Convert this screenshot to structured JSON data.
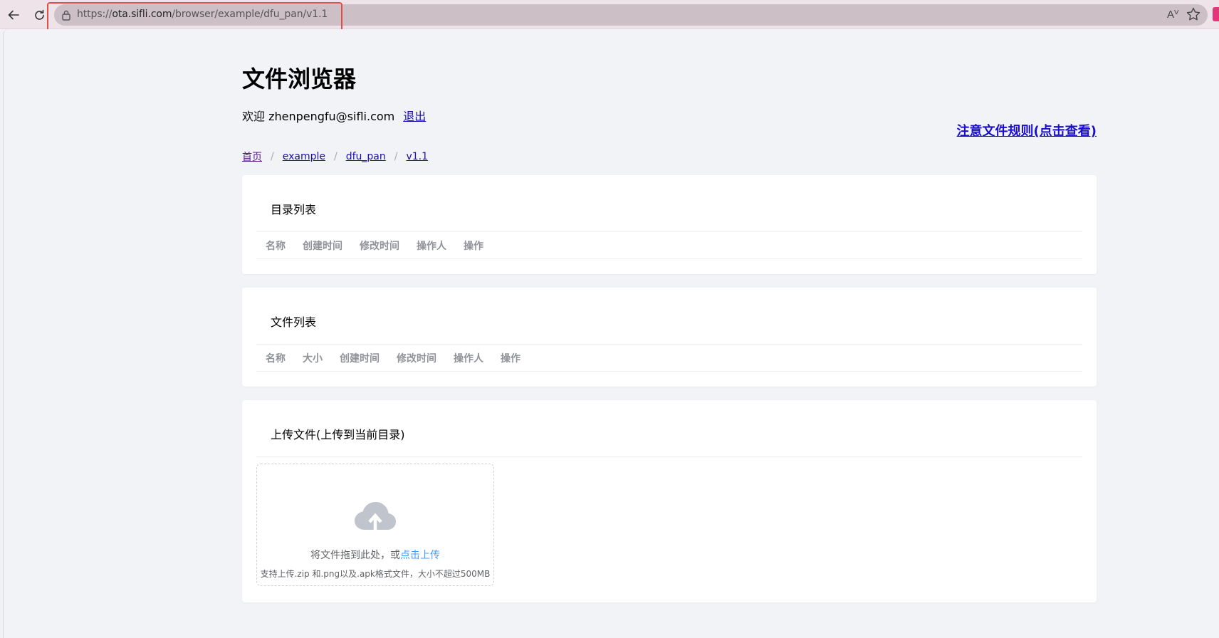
{
  "browser": {
    "url_scheme": "https://",
    "url_host": "ota.sifli.com",
    "url_path": "/browser/example/dfu_pan/v1.1",
    "read_aloud_glyph": "Aⱽ"
  },
  "page": {
    "title": "文件浏览器",
    "welcome_text": "欢迎 zhenpengfu@sifli.com",
    "logout_label": "退出",
    "rules_link": "注意文件规则(点击查看)"
  },
  "breadcrumb": {
    "items": [
      "首页",
      "example",
      "dfu_pan",
      "v1.1"
    ],
    "separator": "/"
  },
  "directory_list": {
    "title": "目录列表",
    "columns": [
      "名称",
      "创建时间",
      "修改时间",
      "操作人",
      "操作"
    ]
  },
  "file_list": {
    "title": "文件列表",
    "columns": [
      "名称",
      "大小",
      "创建时间",
      "修改时间",
      "操作人",
      "操作"
    ]
  },
  "upload": {
    "title": "上传文件(上传到当前目录)",
    "drop_text": "将文件拖到此处，或",
    "click_text": "点击上传",
    "tip": "支持上传.zip 和.png以及.apk格式文件，大小不超过500MB"
  },
  "colors": {
    "accent": "#409eff",
    "link": "#1a0dab",
    "highlight": "#e84a4a"
  }
}
